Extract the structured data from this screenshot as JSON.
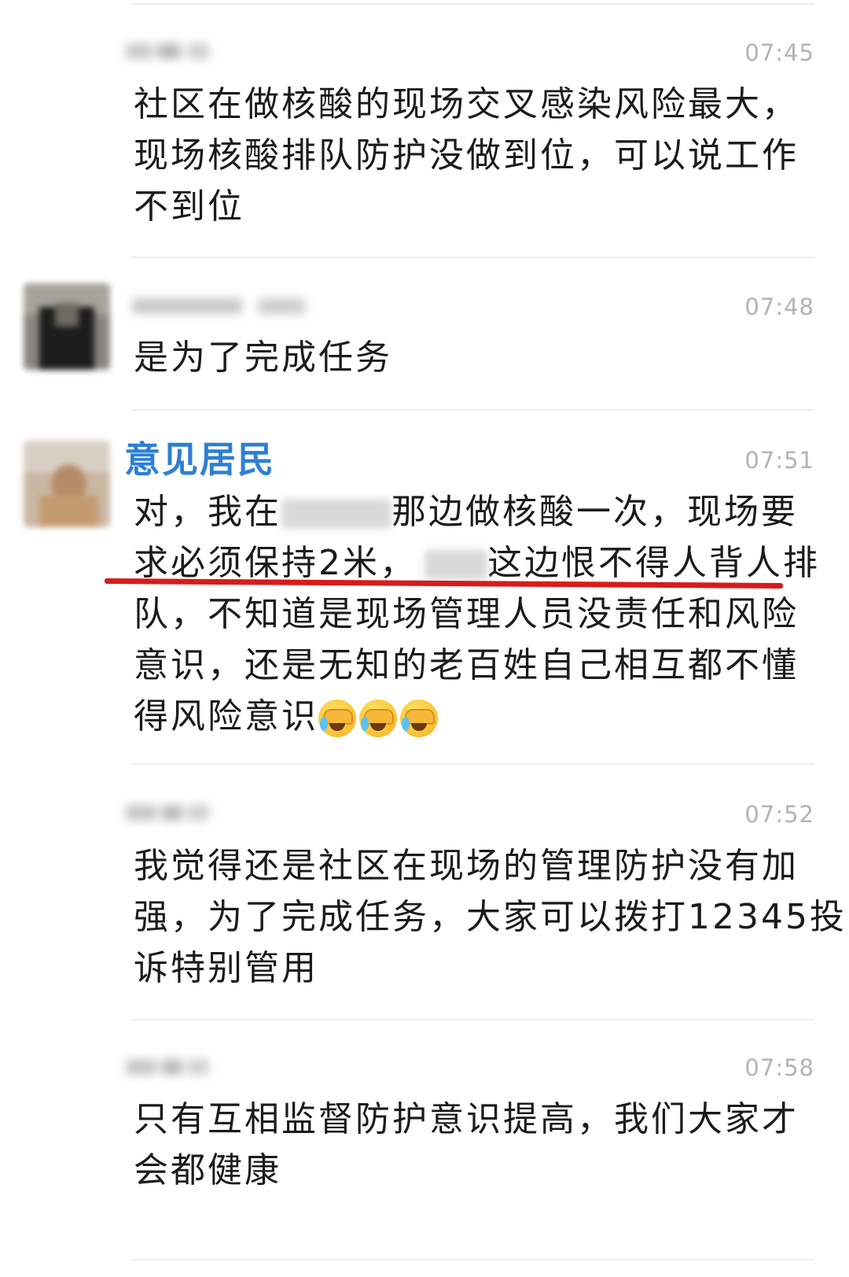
{
  "comments": [
    {
      "time": "07:45",
      "lines": [
        "社区在做核酸的现场交叉感染风险最大，",
        "现场核酸排队防护没做到位，可以说工作",
        "不到位"
      ]
    },
    {
      "time": "07:48",
      "lines": [
        "是为了完成任务"
      ]
    },
    {
      "name": "意见居民",
      "time": "07:51",
      "line1_a": "对，我在",
      "line1_b": "那边做核酸一次，现场要",
      "line2_a": "求必须保持2米，",
      "line2_b": "这边恨不得人背人排",
      "lines_rest": [
        "队，不知道是现场管理人员没责任和风险",
        "意识，还是无知的老百姓自己相互都不懂"
      ],
      "line_last": "得风险意识",
      "emojis": [
        "facepalm-crying-icon",
        "facepalm-crying-icon",
        "facepalm-crying-icon"
      ]
    },
    {
      "time": "07:52",
      "lines": [
        "我觉得还是社区在现场的管理防护没有加",
        "强，为了完成任务，大家可以拨打12345投",
        "诉特别管用"
      ]
    },
    {
      "time": "07:58",
      "lines": [
        "只有互相监督防护意识提高，我们大家才",
        "会都健康"
      ]
    }
  ],
  "colors": {
    "username_blue": "#2d7fd3",
    "underline_red": "#d81b1b",
    "time_gray": "#b3b3b3"
  }
}
